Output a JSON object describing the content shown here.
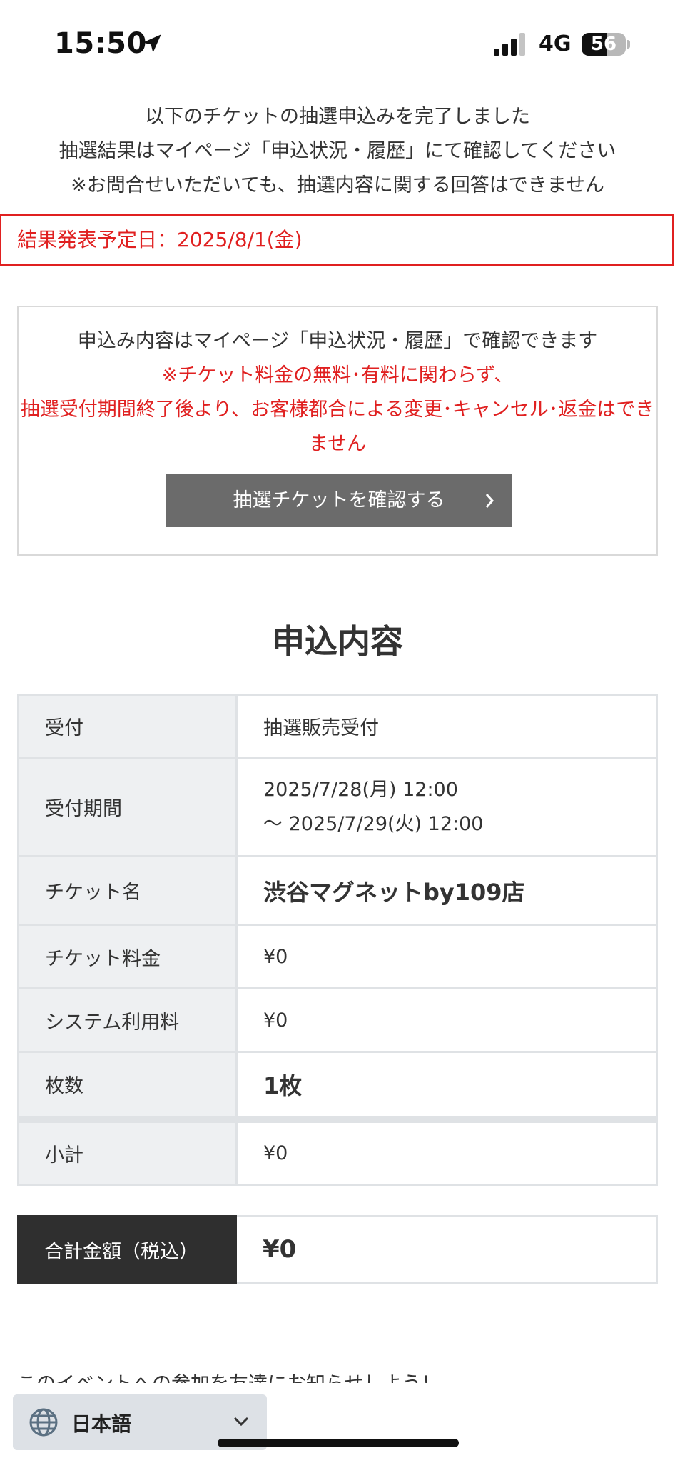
{
  "status_bar": {
    "time": "15:50",
    "network": "4G",
    "battery": "56",
    "battery_level": 0.56
  },
  "completion": {
    "line1": "以下のチケットの抽選申込みを完了しました",
    "line2": "抽選結果はマイページ「申込状況・履歴」にて確認してください",
    "line3": "※お問合せいただいても、抽選内容に関する回答はできません",
    "result_date": "結果発表予定日：2025/8/1(金)"
  },
  "info_box": {
    "line1": "申込み内容はマイページ「申込状況・履歴」で確認できます",
    "warning1": "※チケット料金の無料･有料に関わらず、",
    "warning2": "抽選受付期間終了後より、お客様都合による変更･キャンセル･返金はできません",
    "button_label": "抽選チケットを確認する"
  },
  "section_title": "申込内容",
  "details": {
    "reception_label": "受付",
    "reception_value": "抽選販売受付",
    "period_label": "受付期間",
    "period_start": "2025/7/28(月) 12:00",
    "period_end": "〜 2025/7/29(火) 12:00",
    "ticket_name_label": "チケット名",
    "ticket_name_value": "渋谷マグネットby109店",
    "ticket_price_label": "チケット料金",
    "ticket_price_value": "¥0",
    "system_fee_label": "システム利用料",
    "system_fee_value": "¥0",
    "quantity_label": "枚数",
    "quantity_value": "1枚",
    "subtotal_label": "小計",
    "subtotal_value": "¥0"
  },
  "total": {
    "label": "合計金額（税込）",
    "value": "¥0"
  },
  "share_text": "このイベントへの参加を友達にお知らせしよう！",
  "language": {
    "label": "日本語"
  },
  "colors": {
    "alert_red": "#e02020",
    "button_gray": "#6b6b6b",
    "total_dark": "#2f2f2f",
    "table_key_bg": "#eef0f2"
  }
}
